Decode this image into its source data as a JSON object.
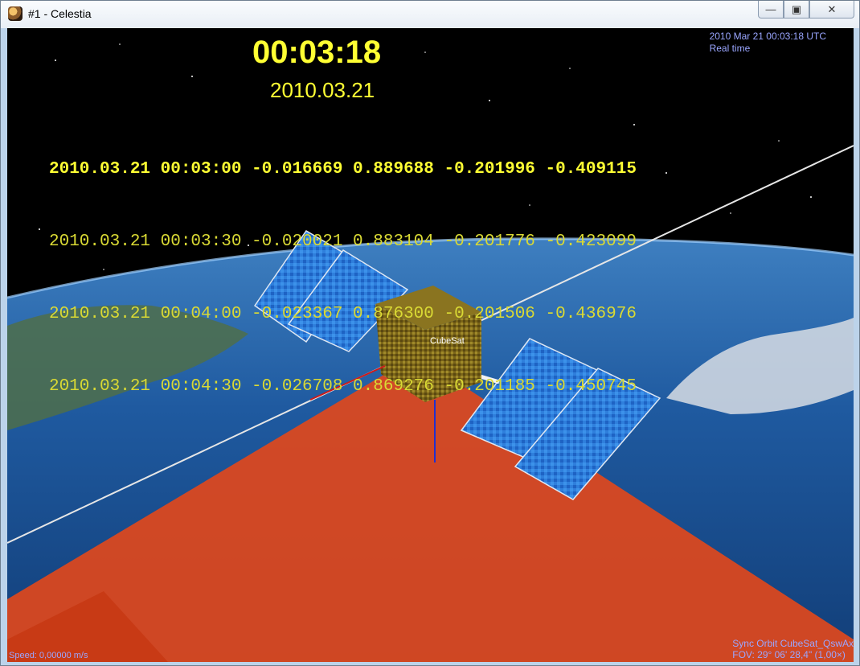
{
  "window": {
    "title": "#1 - Celestia",
    "min_icon": "minimize-icon",
    "max_icon": "maximize-icon",
    "close_icon": "close-icon"
  },
  "overlay": {
    "clock": "00:03:18",
    "date": "2010.03.21",
    "rows": [
      "2010.03.21 00:03:00 -0.016669 0.889688 -0.201996 -0.409115",
      "2010.03.21 00:03:30 -0.020021 0.883104 -0.201776 -0.423099",
      "2010.03.21 00:04:00 -0.023367 0.876300 -0.201506 -0.436976",
      "2010.03.21 00:04:30 -0.026708 0.869276 -0.201185 -0.450745"
    ]
  },
  "hud": {
    "datetime": "2010 Mar 21 00:03:18 UTC",
    "time_rate": "Real time",
    "speed": "Speed: 0,00000 m/s",
    "sync": "Sync Orbit CubeSat_QswAx",
    "fov": "FOV: 29° 06' 28,4\" (1,00×)"
  },
  "scene": {
    "object_label": "CubeSat",
    "beam_color": "#e0481c",
    "earth_color": "#1d4f8f",
    "panel_color": "#2a78d8"
  }
}
